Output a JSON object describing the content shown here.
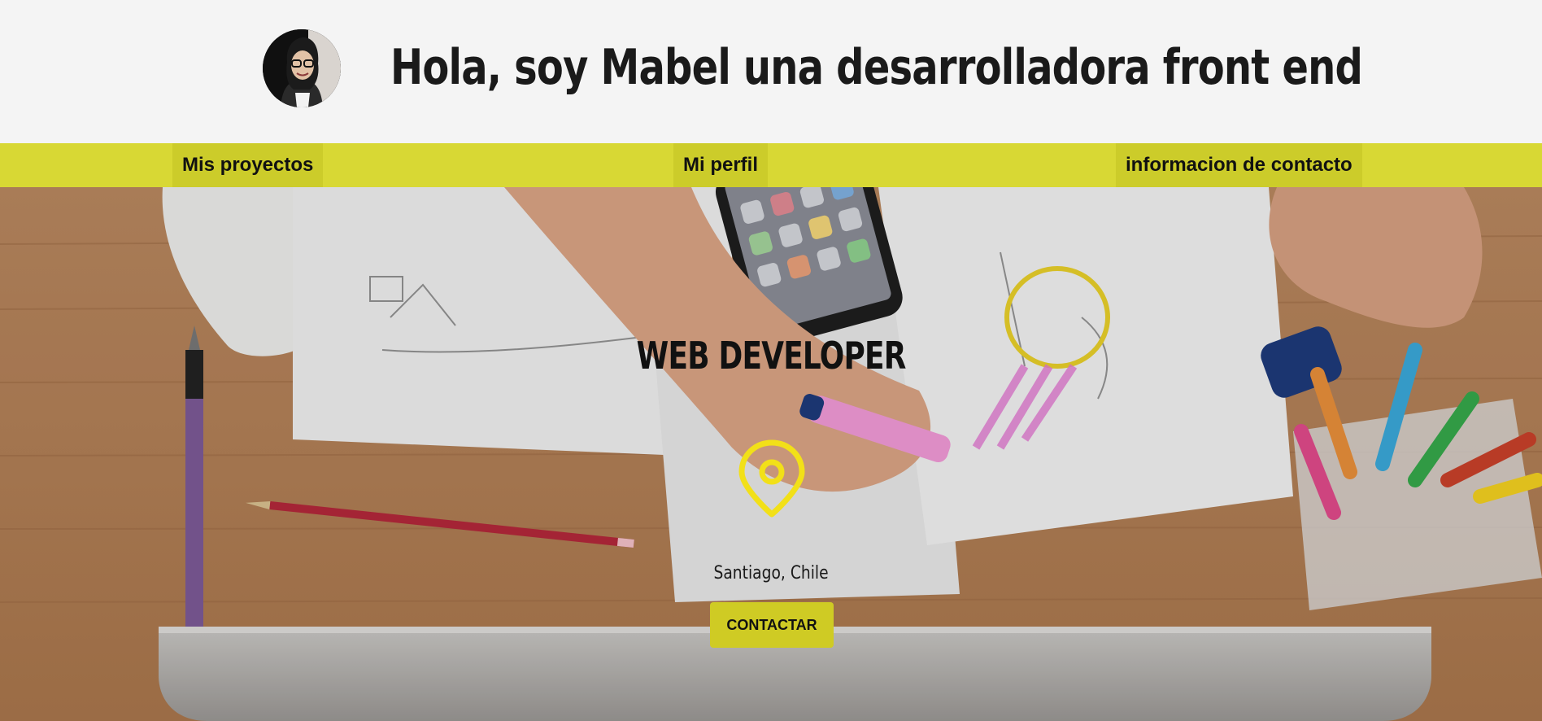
{
  "header": {
    "title": "Hola, soy Mabel una desarrolladora front end",
    "avatar_icon": "profile-photo"
  },
  "nav": {
    "items": [
      {
        "label": "Mis proyectos"
      },
      {
        "label": "Mi perfil"
      },
      {
        "label": "informacion de contacto"
      }
    ]
  },
  "hero": {
    "title": "WEB DEVELOPER",
    "location_icon": "map-pin-icon",
    "location": "Santiago, Chile",
    "button_label": "CONTACTAR"
  },
  "colors": {
    "header_bg": "#f4f4f4",
    "nav_bg": "#d8d834",
    "accent_yellow": "#f2e018",
    "button_bg": "#cfcb24"
  }
}
